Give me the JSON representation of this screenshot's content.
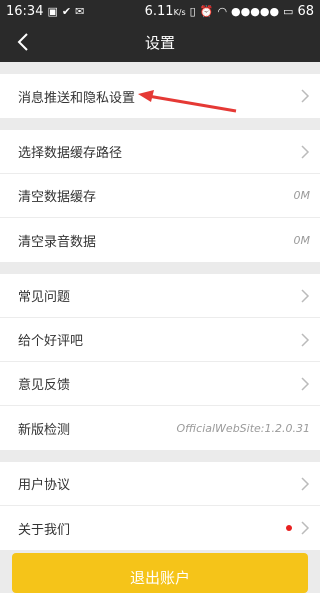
{
  "status": {
    "time": "16:34",
    "speed": "6.11",
    "speed_unit": "K/s",
    "battery": "68"
  },
  "header": {
    "title": "设置"
  },
  "groups": [
    {
      "items": [
        {
          "label": "消息推送和隐私设置"
        }
      ]
    },
    {
      "items": [
        {
          "label": "选择数据缓存路径"
        },
        {
          "label": "清空数据缓存",
          "value": "0M"
        },
        {
          "label": "清空录音数据",
          "value": "0M"
        }
      ]
    },
    {
      "items": [
        {
          "label": "常见问题"
        },
        {
          "label": "给个好评吧"
        },
        {
          "label": "意见反馈"
        },
        {
          "label": "新版检测",
          "value": "OfficialWebSite:1.2.0.31"
        }
      ]
    },
    {
      "items": [
        {
          "label": "用户协议"
        },
        {
          "label": "关于我们"
        }
      ]
    }
  ],
  "logout_label": "退出账户",
  "colors": {
    "accent": "#f5c419",
    "badge": "#e82020",
    "annotation_arrow": "#e53935"
  }
}
